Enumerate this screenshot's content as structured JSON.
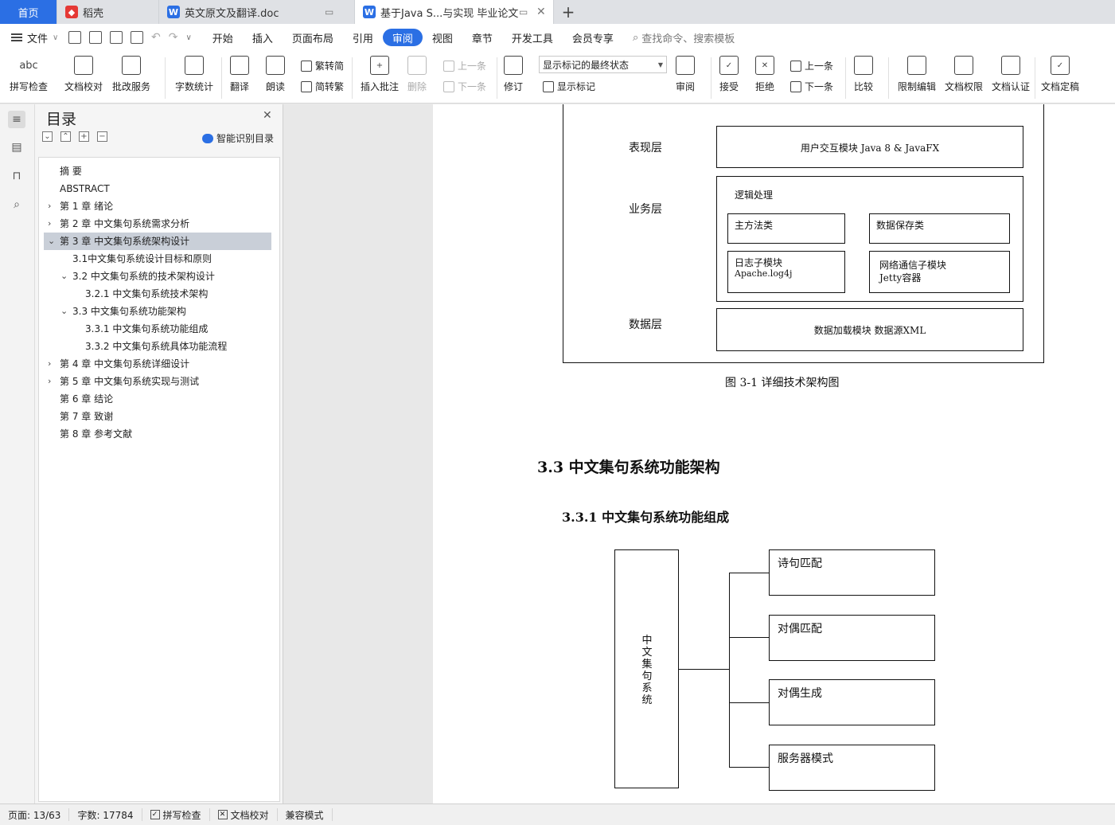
{
  "tabs": [
    {
      "label": "首页",
      "type": "home"
    },
    {
      "label": "稻壳",
      "icon": "docer-icon"
    },
    {
      "label": "英文原文及翻译.doc",
      "icon": "word-doc-icon"
    },
    {
      "label": "基于Java S...与实现 毕业论文",
      "icon": "word-doc-icon",
      "active": true
    }
  ],
  "menu": {
    "file": "文件",
    "items": [
      "开始",
      "插入",
      "页面布局",
      "引用",
      "审阅",
      "视图",
      "章节",
      "开发工具",
      "会员专享"
    ],
    "active": "审阅",
    "search": "查找命令、搜索模板"
  },
  "ribbon": {
    "spell": "拼写检查",
    "proof": "文档校对",
    "review_service": "批改服务",
    "wordcount": "字数统计",
    "translate": "翻译",
    "read": "朗读",
    "trad_to_simp": "繁转简",
    "simp_to_trad": "简转繁",
    "insert_comment": "插入批注",
    "delete": "删除",
    "prev_comment": "上一条",
    "next_comment": "下一条",
    "track_changes": "修订",
    "markup_state": "显示标记的最终状态",
    "show_markup": "显示标记",
    "review_pane": "审阅",
    "accept": "接受",
    "reject": "拒绝",
    "prev_change": "上一条",
    "next_change": "下一条",
    "compare": "比较",
    "restrict_edit": "限制编辑",
    "doc_rights": "文档权限",
    "doc_cert": "文档认证",
    "doc_final": "文档定稿",
    "abc": "abc"
  },
  "toc": {
    "title": "目录",
    "smart": "智能识别目录",
    "items": [
      {
        "label": "摘    要",
        "level": 0,
        "arrow": ""
      },
      {
        "label": "ABSTRACT",
        "level": 0,
        "arrow": ""
      },
      {
        "label": "第 1 章  绪论",
        "level": 0,
        "arrow": "›"
      },
      {
        "label": "第 2 章  中文集句系统需求分析",
        "level": 0,
        "arrow": "›"
      },
      {
        "label": "第 3 章  中文集句系统架构设计",
        "level": 0,
        "arrow": "⌄",
        "selected": true
      },
      {
        "label": "3.1中文集句系统设计目标和原则",
        "level": 1,
        "arrow": ""
      },
      {
        "label": "3.2  中文集句系统的技术架构设计",
        "level": 1,
        "arrow": "⌄"
      },
      {
        "label": "3.2.1  中文集句系统技术架构",
        "level": 2,
        "arrow": ""
      },
      {
        "label": "3.3  中文集句系统功能架构",
        "level": 1,
        "arrow": "⌄"
      },
      {
        "label": "3.3.1    中文集句系统功能组成",
        "level": 2,
        "arrow": ""
      },
      {
        "label": "3.3.2    中文集句系统具体功能流程",
        "level": 2,
        "arrow": ""
      },
      {
        "label": "第 4 章  中文集句系统详细设计",
        "level": 0,
        "arrow": "›"
      },
      {
        "label": "第 5 章  中文集句系统实现与测试",
        "level": 0,
        "arrow": "›"
      },
      {
        "label": "第 6 章  结论",
        "level": 0,
        "arrow": ""
      },
      {
        "label": "第 7 章  致谢",
        "level": 0,
        "arrow": ""
      },
      {
        "label": "第 8 章  参考文献",
        "level": 0,
        "arrow": ""
      }
    ]
  },
  "document": {
    "arch": {
      "presentation_label": "表现层",
      "presentation_box": "用户交互模块 Java 8 & JavaFX",
      "business_label": "业务层",
      "logic": "逻辑处理",
      "main_class": "主方法类",
      "data_save": "数据保存类",
      "log_module": "日志子模块",
      "log_lib": "Apache.log4j",
      "net_module": "网络通信子模块",
      "net_lib": "Jetty容器",
      "data_label": "数据层",
      "data_box": "数据加载模块 数据源XML"
    },
    "figure_caption": "图 3-1 详细技术架构图",
    "heading_33": "3.3 中文集句系统功能架构",
    "heading_331": "3.3.1    中文集句系统功能组成",
    "func": {
      "root": "中文集句系统",
      "items": [
        "诗句匹配",
        "对偶匹配",
        "对偶生成",
        "服务器模式"
      ]
    }
  },
  "status": {
    "page": "页面: 13/63",
    "words": "字数: 17784",
    "spell": "拼写检查",
    "proof": "文档校对",
    "compat": "兼容模式"
  }
}
